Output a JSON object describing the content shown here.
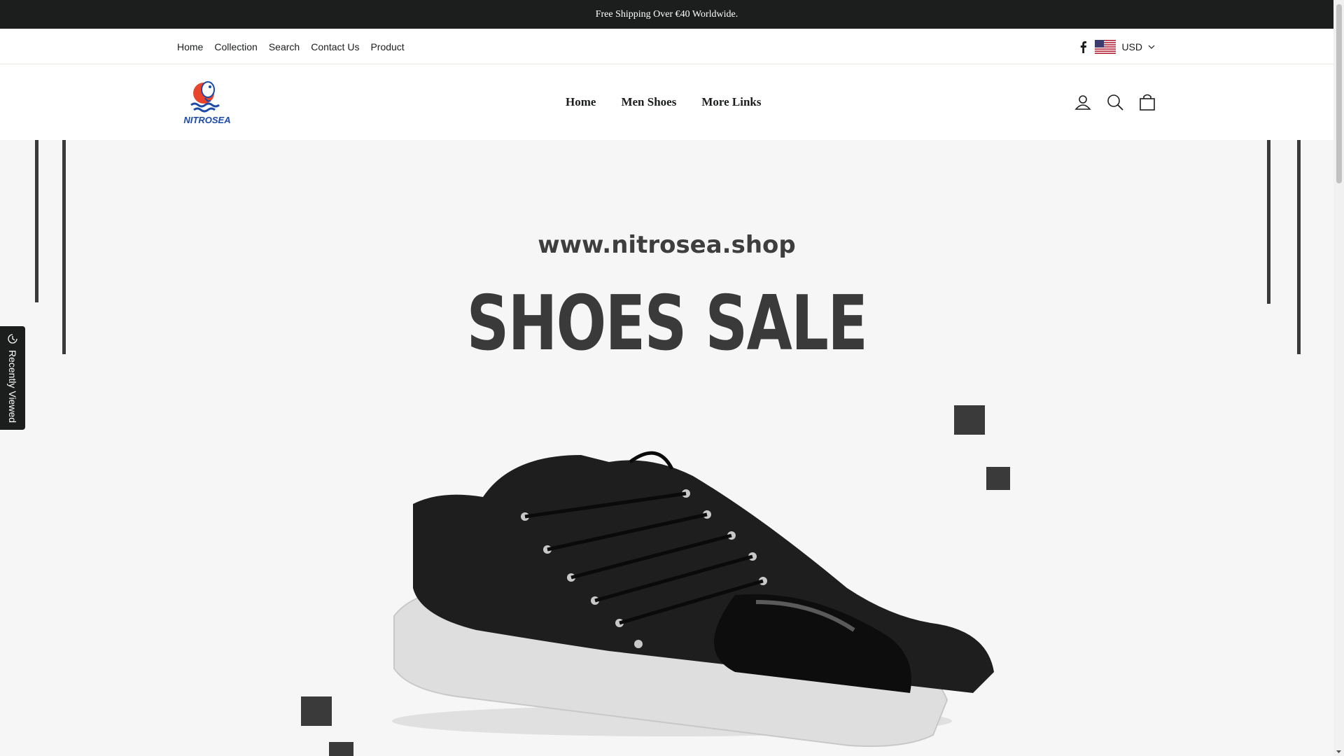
{
  "announcement": {
    "text": "Free Shipping Over €40 Worldwide."
  },
  "toolbar": {
    "links": [
      "Home",
      "Collection",
      "Search",
      "Contact Us",
      "Product"
    ],
    "social_icon": "facebook-icon",
    "currency": {
      "flag": "us-flag-icon",
      "code": "USD"
    }
  },
  "header": {
    "logo_text": "NITROSEA",
    "nav": [
      "Home",
      "Men Shoes",
      "More Links"
    ],
    "icons": [
      "account-icon",
      "search-icon",
      "cart-icon"
    ]
  },
  "hero": {
    "domain": "www.nitrosea.shop",
    "title": "SHOES SALE"
  },
  "recently_viewed": {
    "label": "Recently Viewed"
  },
  "colors": {
    "announcement_bg": "#1c1d1d",
    "hero_bg": "#f6f6f6",
    "text": "#1c1d1d",
    "logo_red": "#e8452c",
    "logo_blue": "#1b4aa8"
  }
}
